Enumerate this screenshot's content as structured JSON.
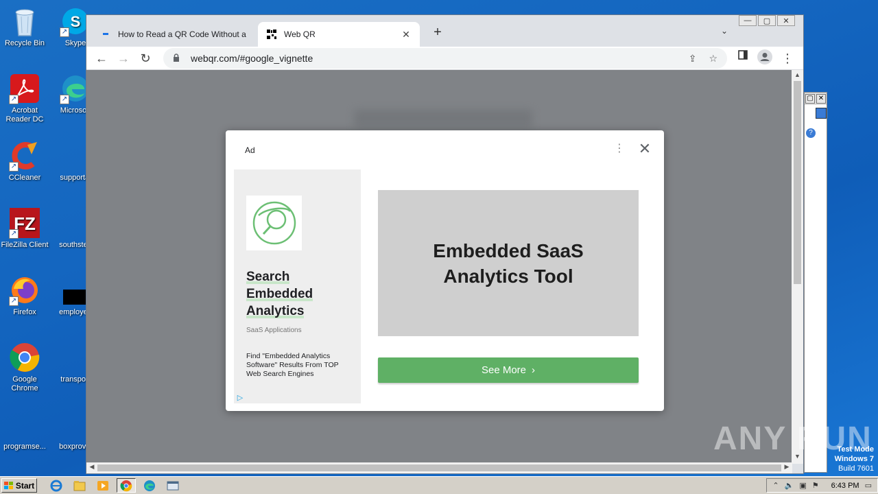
{
  "desktop": {
    "icons": [
      {
        "label": "Recycle Bin"
      },
      {
        "label": "Skype"
      },
      {
        "label": "Acrobat Reader DC"
      },
      {
        "label": "Microsoft"
      },
      {
        "label": "CCleaner"
      },
      {
        "label": "supportal"
      },
      {
        "label": "FileZilla Client"
      },
      {
        "label": "southstep"
      },
      {
        "label": "Firefox"
      },
      {
        "label": "employee"
      },
      {
        "label": "Google Chrome"
      },
      {
        "label": "transport"
      },
      {
        "label": "programse..."
      },
      {
        "label": "boxprovid"
      }
    ]
  },
  "browser": {
    "tabs": [
      {
        "title": "How to Read a QR Code Without a C",
        "active": false
      },
      {
        "title": "Web QR",
        "active": true
      }
    ],
    "close_glyph": "✕",
    "newtab_glyph": "+",
    "tabsearch_glyph": "⌄",
    "window_controls": {
      "minimize": "—",
      "maximize": "▢",
      "close": "✕"
    },
    "toolbar": {
      "back_glyph": "←",
      "forward_glyph": "→",
      "reload_glyph": "↻",
      "url": "webqr.com/#google_vignette",
      "share_glyph": "⇪",
      "star_glyph": "☆",
      "menu_glyph": "⋮"
    }
  },
  "ad": {
    "label": "Ad",
    "menu_glyph": "⋮",
    "close_glyph": "✕",
    "headline_lines": [
      "Search",
      "Embedded",
      "Analytics"
    ],
    "subtitle": "SaaS Applications",
    "description": "Find \"Embedded Analytics Software\" Results From TOP Web Search Engines",
    "banner_lines": [
      "Embedded SaaS",
      "Analytics Tool"
    ],
    "cta": "See More",
    "cta_chevron": "›",
    "accent_color": "#5fb065"
  },
  "watermark": {
    "text": "ANY RUN",
    "test_mode": "Test Mode",
    "os": "Windows 7",
    "build": "Build 7601"
  },
  "taskbar": {
    "start_label": "Start",
    "clock": "6:43 PM"
  }
}
